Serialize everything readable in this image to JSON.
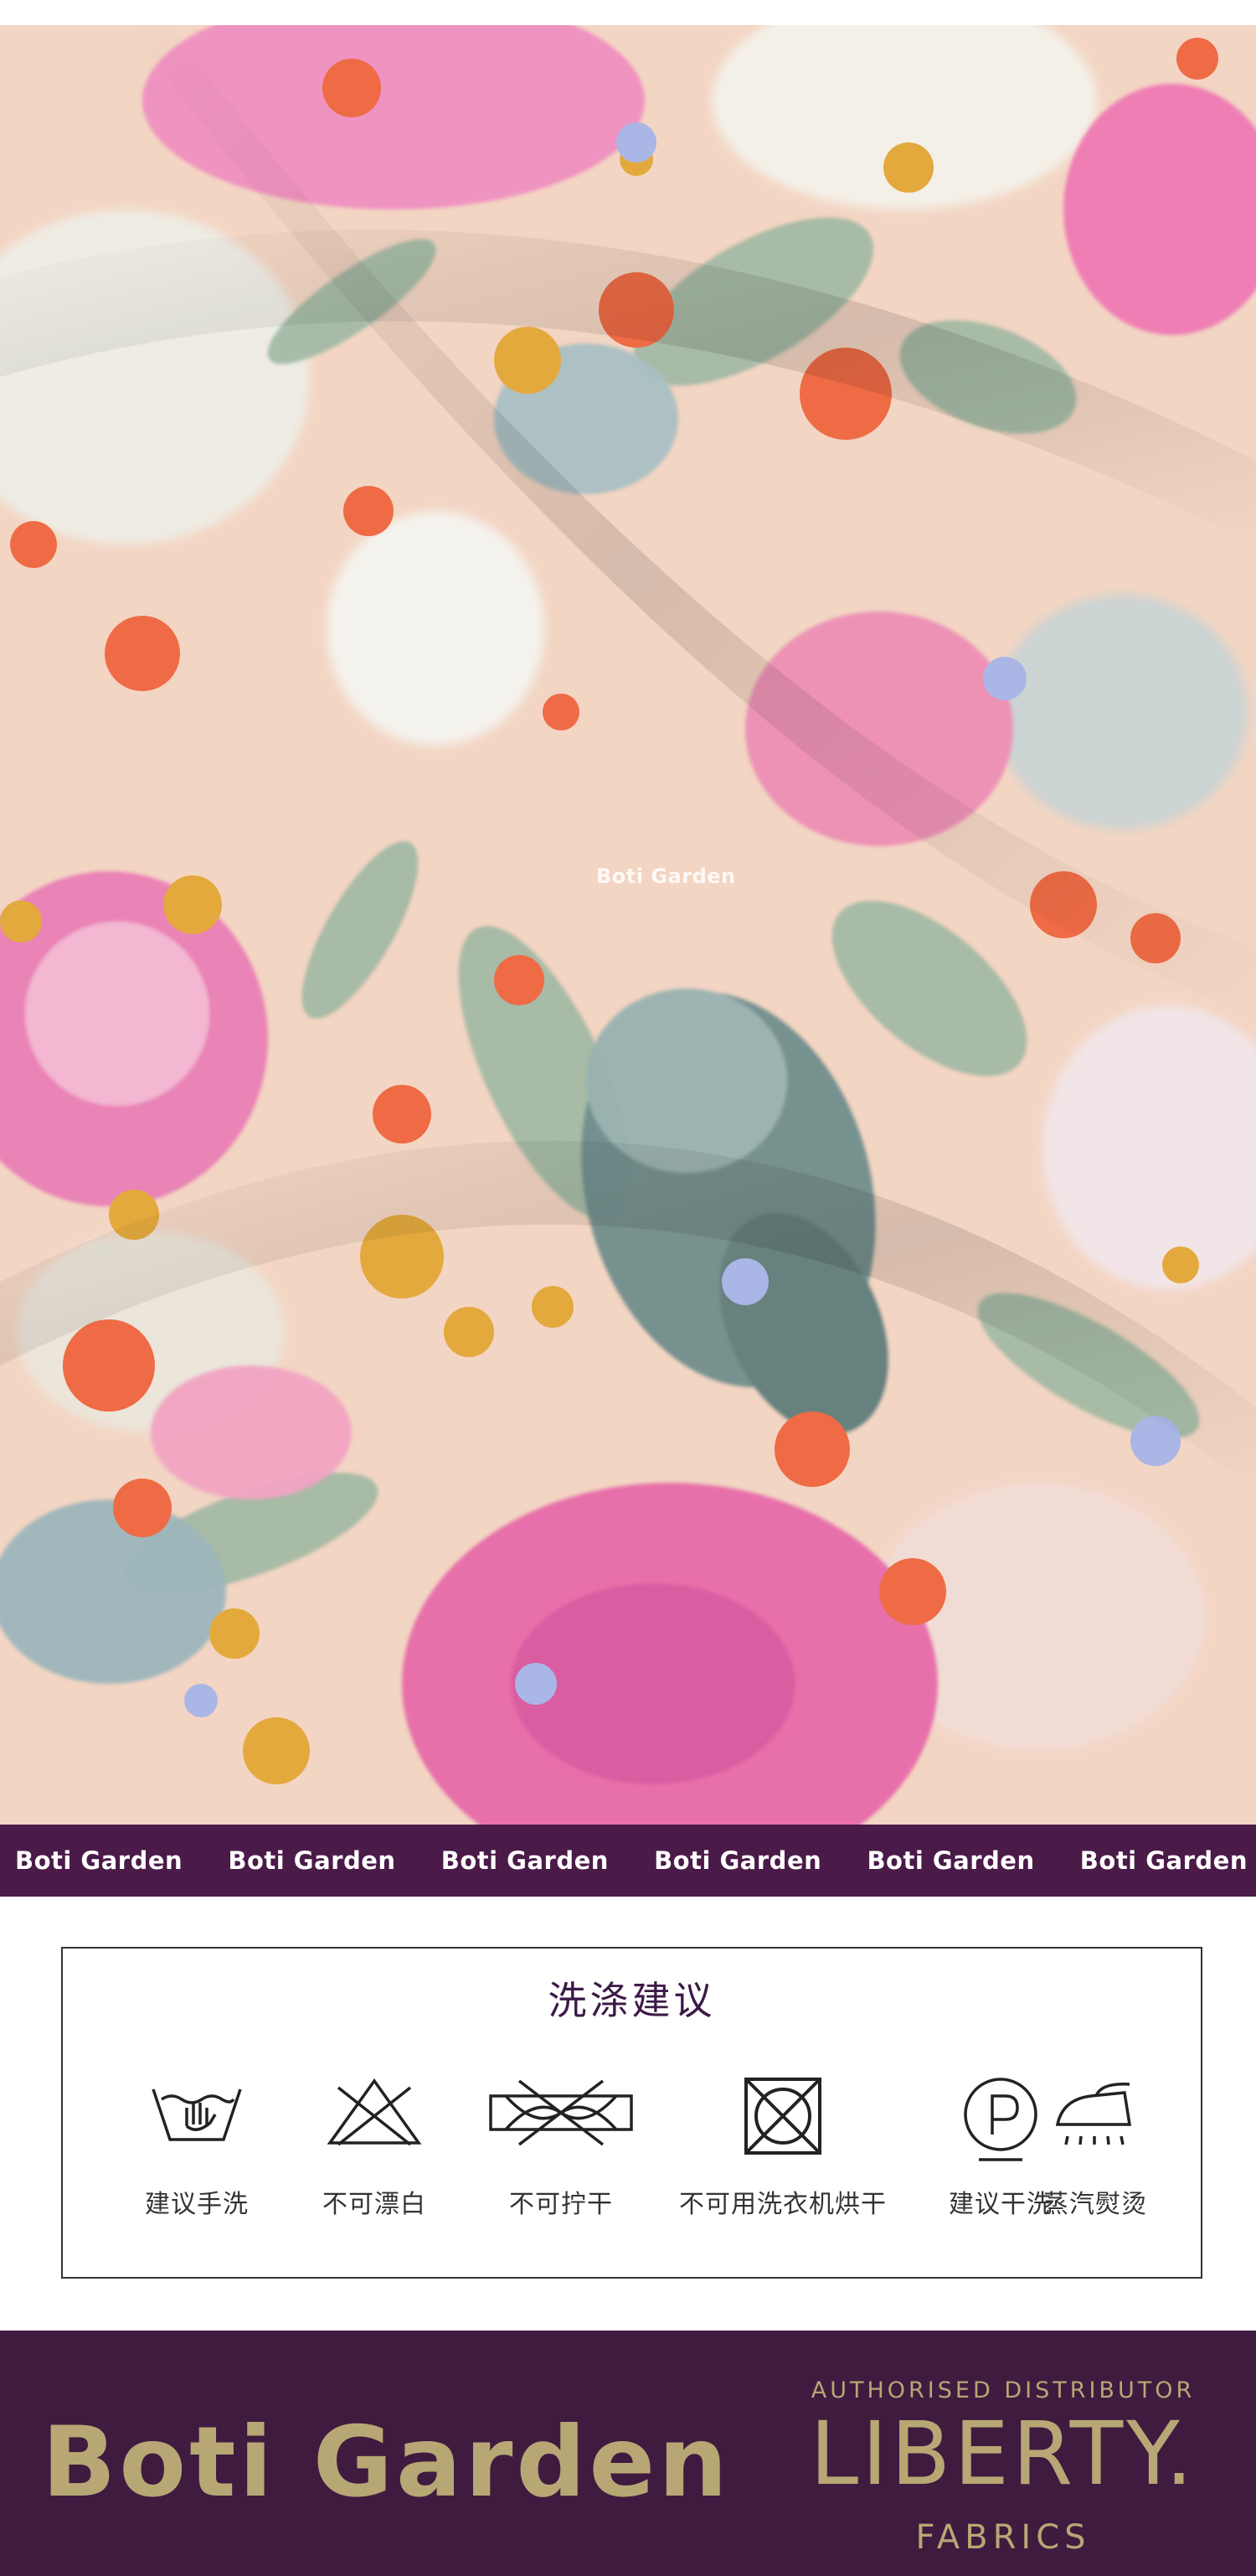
{
  "fabric": {
    "watermark": "Boti Garden"
  },
  "brand_strip": {
    "items": [
      "Boti Garden",
      "Boti Garden",
      "Boti Garden",
      "Boti Garden",
      "Boti Garden",
      "Boti Garden"
    ]
  },
  "care": {
    "title": "洗涤建议",
    "items": [
      {
        "icon": "hand-wash-icon",
        "label": "建议手洗"
      },
      {
        "icon": "no-bleach-icon",
        "label": "不可漂白"
      },
      {
        "icon": "no-wring-icon",
        "label": "不可拧干"
      },
      {
        "icon": "no-tumble-dry-icon",
        "label": "不可用洗衣机烘干"
      },
      {
        "icon": "dry-clean-icon",
        "label": "建议干洗"
      },
      {
        "icon": "steam-iron-icon",
        "label": "蒸汽熨烫"
      }
    ]
  },
  "footer": {
    "brand": "Boti Garden",
    "authorised": "AUTHORISED DISTRIBUTOR",
    "liberty": "LIBERTY.",
    "fabrics": "FABRICS"
  },
  "colors": {
    "strip_purple": "#4a1a48",
    "footer_purple": "#3f1b40",
    "gold": "#b7a774",
    "title_purple": "#3c1a47"
  }
}
